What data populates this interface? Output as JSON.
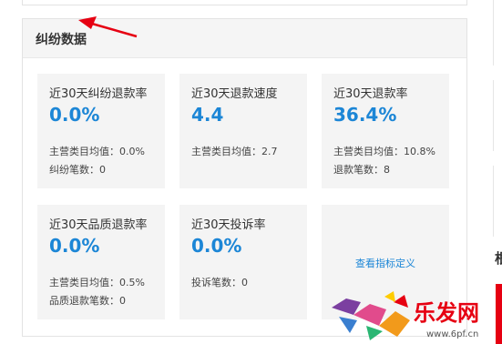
{
  "section": {
    "title": "纠纷数据"
  },
  "cards": [
    {
      "label": "近30天纠纷退款率",
      "value": "0.0%",
      "sub1": "主营类目均值：0.0%",
      "sub2": "纠纷笔数：0"
    },
    {
      "label": "近30天退款速度",
      "value": "4.4",
      "sub1": "主营类目均值：2.7",
      "sub2": ""
    },
    {
      "label": "近30天退款率",
      "value": "36.4%",
      "sub1": "主营类目均值：10.8%",
      "sub2": "退款笔数：8"
    },
    {
      "label": "近30天品质退款率",
      "value": "0.0%",
      "sub1": "主营类目均值：0.5%",
      "sub2": "品质退款笔数：0"
    },
    {
      "label": "近30天投诉率",
      "value": "0.0%",
      "sub1": "投诉笔数：0",
      "sub2": ""
    }
  ],
  "link_card": {
    "label": "查看指标定义"
  },
  "sidebar": {
    "partial_char": "根"
  },
  "watermark": {
    "brand": "乐发网",
    "url": "www.6pf.cn"
  },
  "colors": {
    "accent": "#1c86d6",
    "card_bg": "#f4f4f4",
    "header_bg": "#f5f5f5",
    "brand_red": "#e60012"
  }
}
